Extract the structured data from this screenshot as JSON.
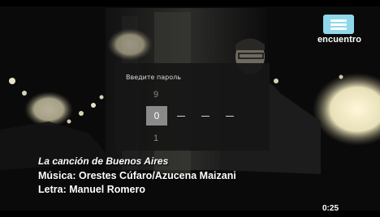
{
  "channel": {
    "logo_text": "encuentro",
    "logo_color": "#8fd7ea"
  },
  "password_dialog": {
    "title": "Введите пароль",
    "digit_previous": "9",
    "digit_current": "0",
    "digit_next": "1",
    "remaining_placeholders": [
      "—",
      "—",
      "—"
    ]
  },
  "credits": {
    "song_title": "La canción de Buenos Aires",
    "music": "Música: Orestes Cúfaro/Azucena Maizani",
    "lyrics": "Letra: Manuel Romero"
  },
  "playback": {
    "elapsed": "0:25"
  }
}
